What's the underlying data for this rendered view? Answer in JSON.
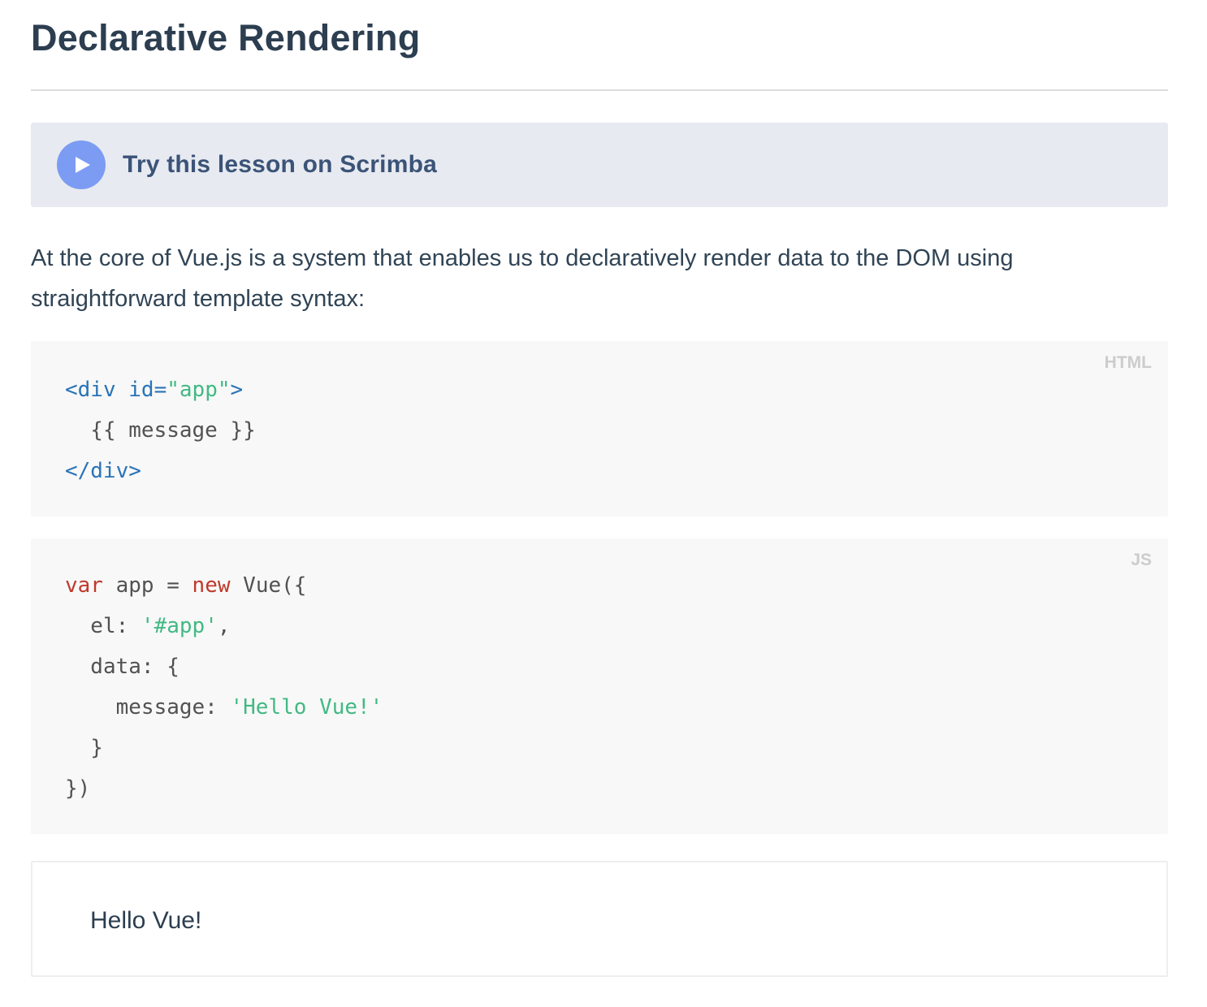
{
  "page": {
    "title": "Declarative Rendering"
  },
  "scrimba": {
    "label": "Try this lesson on Scrimba",
    "icon": "play-icon",
    "icon_color": "#7c9cf3"
  },
  "intro": {
    "text": "At the core of Vue.js is a system that enables us to declaratively render data to the DOM using straightforward template syntax:"
  },
  "code_html": {
    "lang": "HTML",
    "lines": [
      [
        {
          "t": "tag",
          "v": "<div"
        },
        {
          "t": "plain",
          "v": " "
        },
        {
          "t": "tag",
          "v": "id="
        },
        {
          "t": "str",
          "v": "\"app\""
        },
        {
          "t": "tag",
          "v": ">"
        }
      ],
      [
        {
          "t": "plain",
          "v": "  {{ message }}"
        }
      ],
      [
        {
          "t": "tag",
          "v": "</div>"
        }
      ]
    ]
  },
  "code_js": {
    "lang": "JS",
    "lines": [
      [
        {
          "t": "kw",
          "v": "var"
        },
        {
          "t": "plain",
          "v": " app = "
        },
        {
          "t": "kw",
          "v": "new"
        },
        {
          "t": "plain",
          "v": " Vue({"
        }
      ],
      [
        {
          "t": "plain",
          "v": "  el: "
        },
        {
          "t": "str",
          "v": "'#app'"
        },
        {
          "t": "plain",
          "v": ","
        }
      ],
      [
        {
          "t": "plain",
          "v": "  data: {"
        }
      ],
      [
        {
          "t": "plain",
          "v": "    message: "
        },
        {
          "t": "str",
          "v": "'Hello Vue!'"
        }
      ],
      [
        {
          "t": "plain",
          "v": "  }"
        }
      ],
      [
        {
          "t": "plain",
          "v": "})"
        }
      ]
    ]
  },
  "demo": {
    "output": "Hello Vue!"
  },
  "colors": {
    "heading": "#2c3e50",
    "code_tag": "#2973b7",
    "code_string": "#42b983",
    "code_keyword": "#c0392b",
    "banner_bg": "#e7eaf0"
  }
}
